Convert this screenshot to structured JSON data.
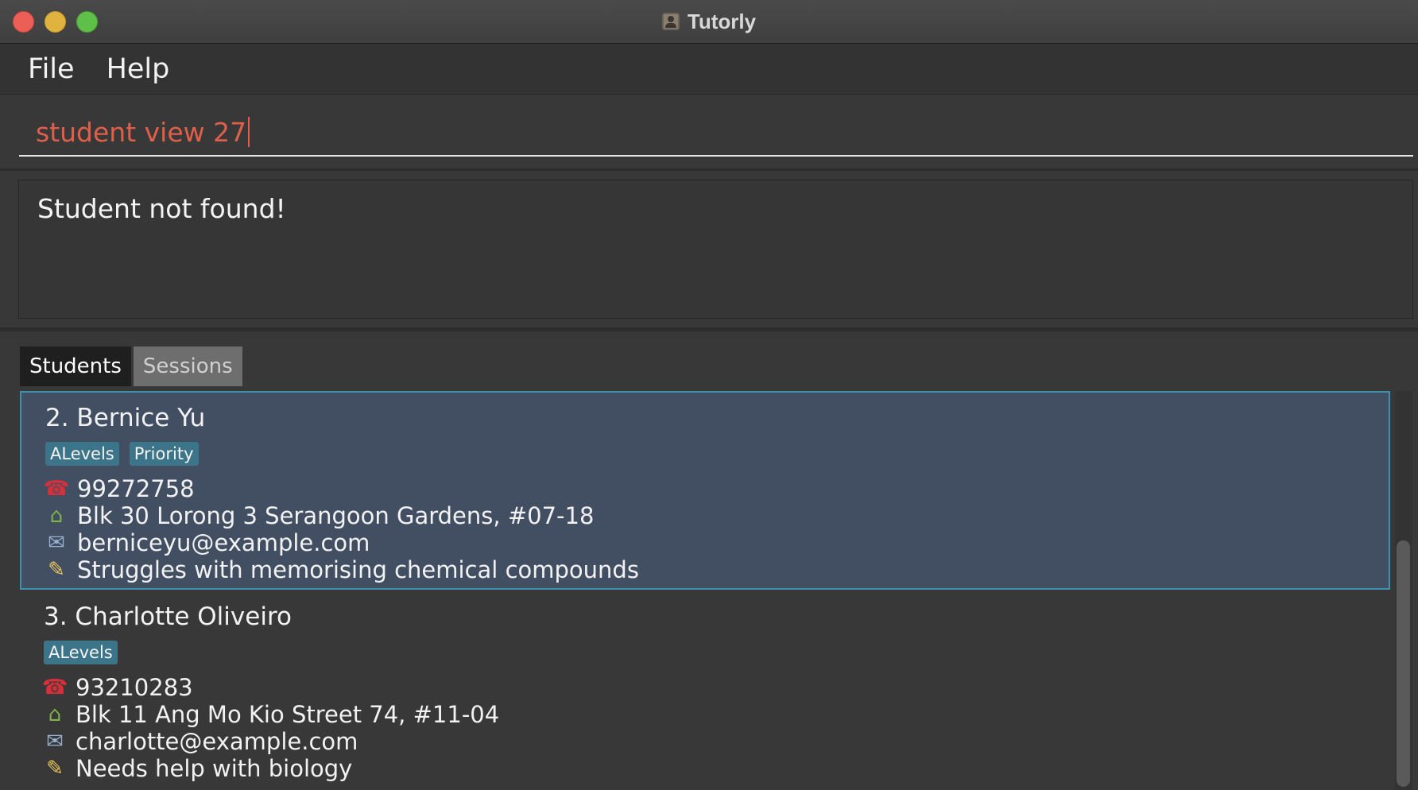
{
  "window": {
    "title": "Tutorly",
    "app_icon": "contact-person-icon"
  },
  "menu": {
    "items": [
      {
        "label": "File"
      },
      {
        "label": "Help"
      }
    ]
  },
  "command": {
    "value": "student view 27"
  },
  "result": {
    "message": "Student not found!"
  },
  "tabs": [
    {
      "label": "Students",
      "active": true
    },
    {
      "label": "Sessions",
      "active": false
    }
  ],
  "students": [
    {
      "name": "2. Bernice Yu",
      "tags": [
        "ALevels",
        "Priority"
      ],
      "phone": "99272758",
      "address": "Blk 30 Lorong 3 Serangoon Gardens, #07-18",
      "email": "berniceyu@example.com",
      "notes": "Struggles with memorising chemical compounds",
      "selected": true
    },
    {
      "name": "3. Charlotte Oliveiro",
      "tags": [
        "ALevels"
      ],
      "phone": "93210283",
      "address": "Blk 11 Ang Mo Kio Street 74, #11-04",
      "email": "charlotte@example.com",
      "notes": "Needs help with biology",
      "selected": false
    }
  ],
  "colors": {
    "accent_selection": "#3f8fb0",
    "tag_bg": "#3c7489",
    "command_text": "#e05f4a",
    "close": "#ec5f57",
    "minimize": "#e0b33f",
    "zoom": "#5ec048"
  }
}
